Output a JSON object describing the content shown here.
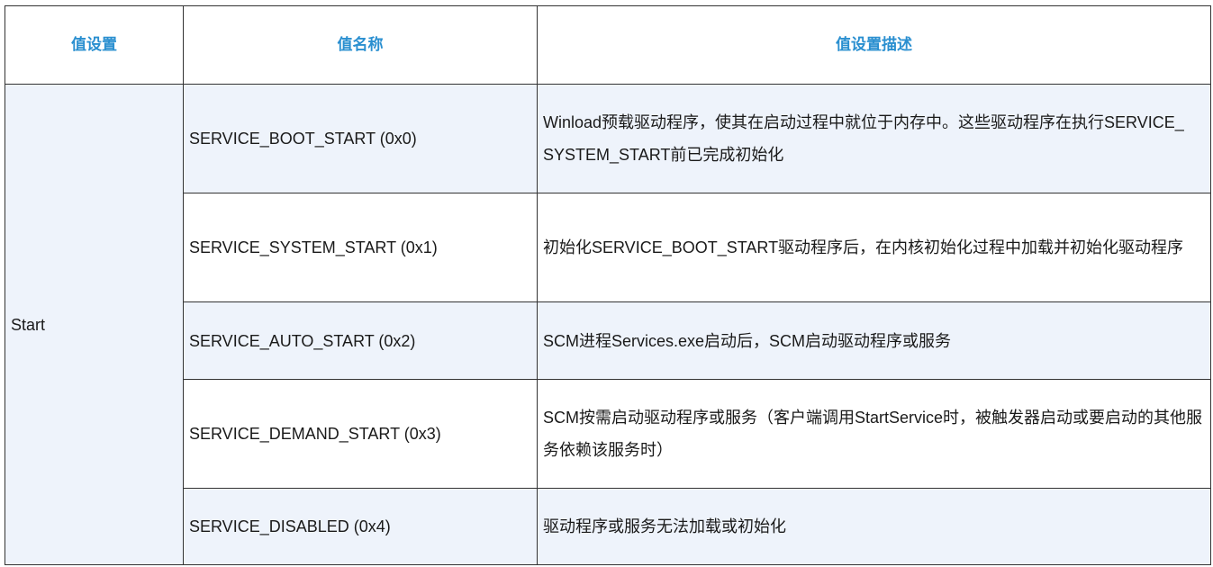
{
  "headers": {
    "value_setting": "值设置",
    "value_name": "值名称",
    "description": "值设置描述"
  },
  "start_label": "Start",
  "rows": [
    {
      "name": "SERVICE_BOOT_START (0x0)",
      "desc": "Winload预载驱动程序，使其在启动过程中就位于内存中。这些驱动程序在执行SERVICE_ SYSTEM_START前已完成初始化"
    },
    {
      "name": "SERVICE_SYSTEM_START (0x1)",
      "desc": "初始化SERVICE_BOOT_START驱动程序后，在内核初始化过程中加载并初始化驱动程序"
    },
    {
      "name": "SERVICE_AUTO_START (0x2)",
      "desc": "SCM进程Services.exe启动后，SCM启动驱动程序或服务"
    },
    {
      "name": "SERVICE_DEMAND_START (0x3)",
      "desc": "SCM按需启动驱动程序或服务（客户端调用StartService时，被触发器启动或要启动的其他服务依赖该服务时）"
    },
    {
      "name": "SERVICE_DISABLED (0x4)",
      "desc": "驱动程序或服务无法加载或初始化"
    }
  ],
  "colors": {
    "header_text": "#2a8fd0",
    "shaded_row": "#eef3fb",
    "border": "#333333"
  }
}
